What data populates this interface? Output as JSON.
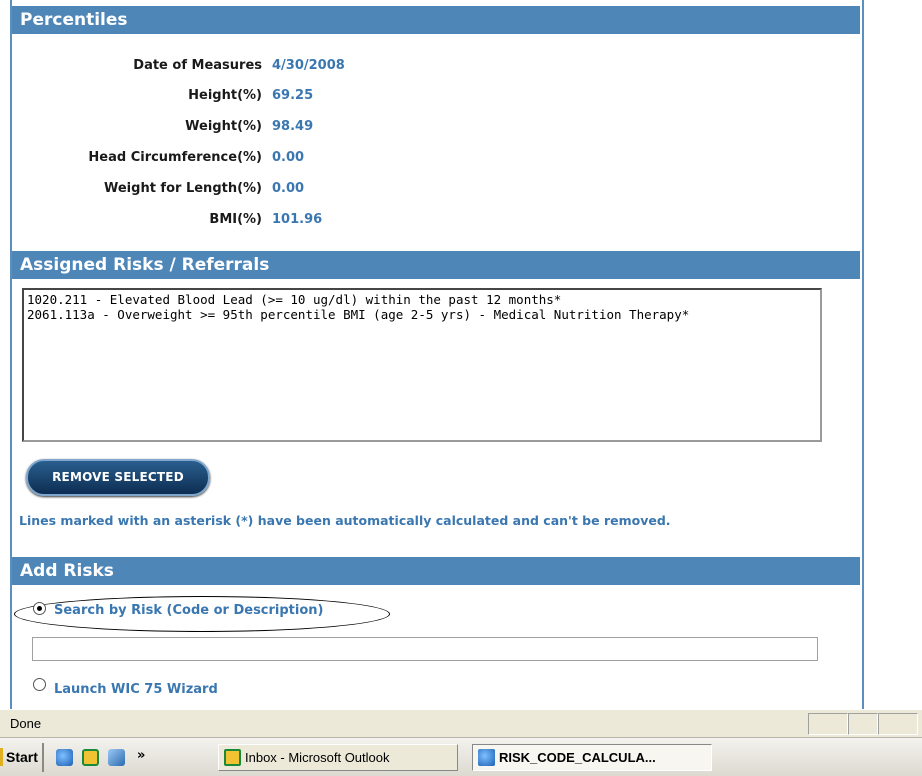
{
  "percentiles": {
    "title": "Percentiles",
    "rows": [
      {
        "label": "Date of Measures",
        "value": "4/30/2008"
      },
      {
        "label": "Height(%)",
        "value": "69.25"
      },
      {
        "label": "Weight(%)",
        "value": "98.49"
      },
      {
        "label": "Head Circumference(%)",
        "value": "0.00"
      },
      {
        "label": "Weight for Length(%)",
        "value": "0.00"
      },
      {
        "label": "BMI(%)",
        "value": "101.96"
      }
    ]
  },
  "assigned_risks": {
    "title": "Assigned Risks / Referrals",
    "items": [
      "1020.211 - Elevated Blood Lead (>= 10 ug/dl) within the past 12 months*",
      "2061.113a - Overweight >= 95th percentile BMI (age 2-5 yrs) - Medical Nutrition Therapy*"
    ],
    "remove_button": "REMOVE SELECTED",
    "note": "Lines marked with an asterisk (*) have been automatically calculated and can't be removed."
  },
  "add_risks": {
    "title": "Add Risks",
    "search_option": "Search by Risk (Code or Description)",
    "search_value": "",
    "wizard_option": "Launch WIC 75 Wizard"
  },
  "statusbar": {
    "text": "Done"
  },
  "taskbar": {
    "start": "Start",
    "chevron": "»",
    "tasks": [
      {
        "label": "Inbox - Microsoft Outlook"
      },
      {
        "label": "RISK_CODE_CALCULA..."
      }
    ]
  },
  "colors": {
    "header": "#4e86b8",
    "value_text": "#3a77b0"
  }
}
